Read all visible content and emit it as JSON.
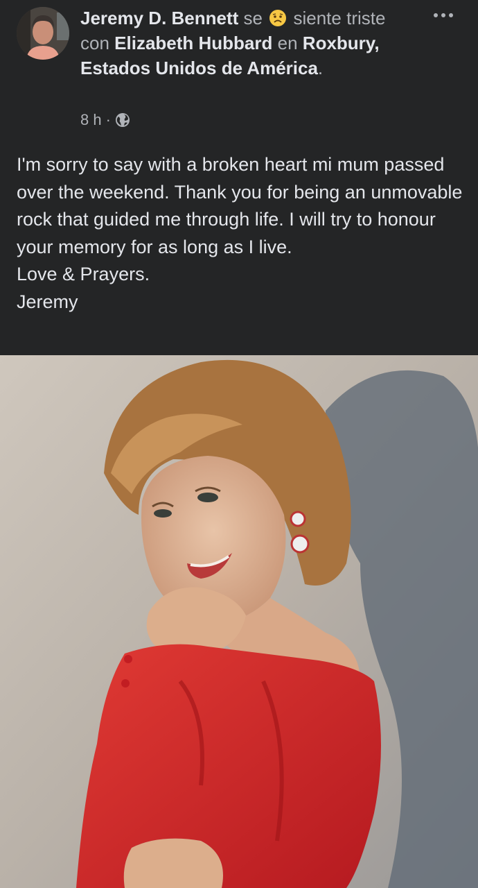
{
  "post": {
    "author_name": "Jeremy D. Bennett",
    "feeling_prefix": "se",
    "feeling_text": "siente",
    "feeling_rest": "triste con",
    "tagged_name": "Elizabeth Hubbard",
    "location_prefix": "en",
    "location": "Roxbury, Estados Unidos de América",
    "location_suffix": ".",
    "timestamp": "8 h",
    "separator": "·",
    "privacy_icon": "globe-icon",
    "feeling_icon": "sad-face-emoji-icon",
    "more_icon": "more-options-icon",
    "body_lines": [
      "I'm sorry to say with a broken heart mi mum passed over the weekend. Thank you for being an unmovable rock that guided me through life. I will try to honour your memory for as long as I live.",
      "Love & Prayers.",
      "Jeremy"
    ]
  },
  "colors": {
    "background": "#242526",
    "primary_text": "#e4e6eb",
    "secondary_text": "#b0b3b8",
    "photo_dress": "#d4262a"
  }
}
